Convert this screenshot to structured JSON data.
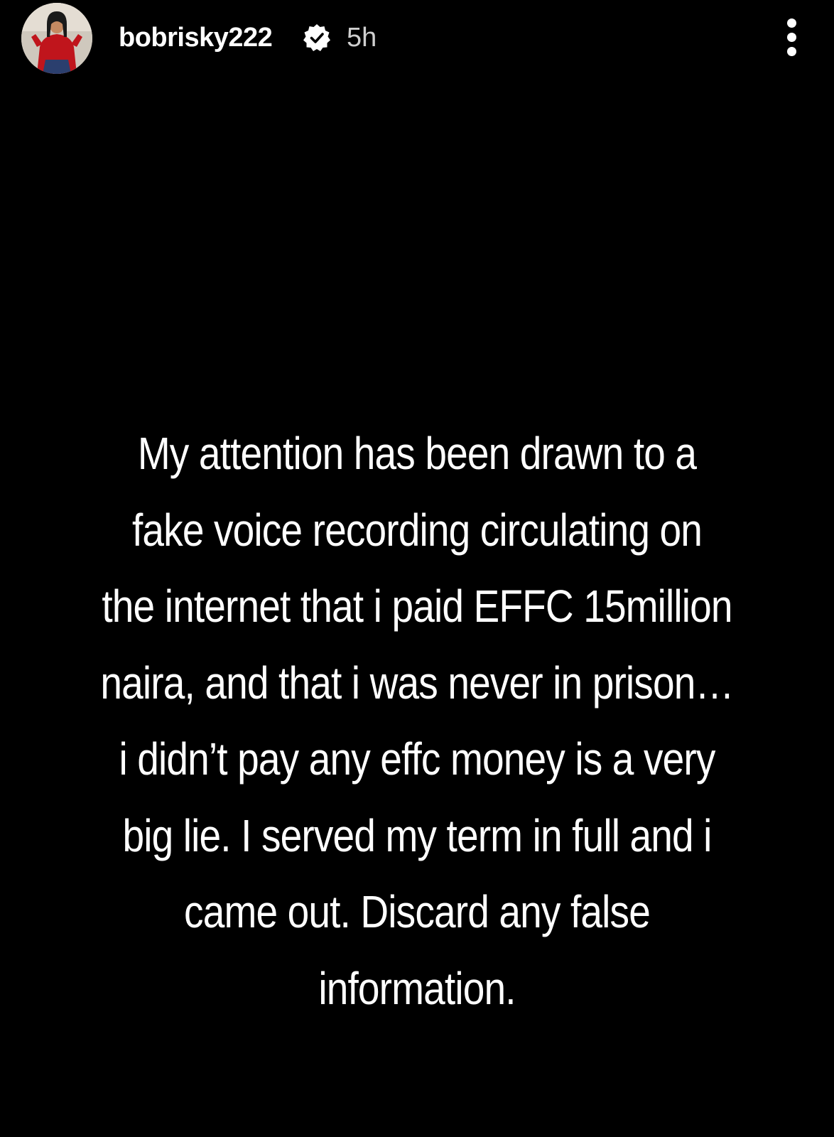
{
  "story": {
    "header": {
      "username": "bobrisky222",
      "time_ago": "5h",
      "verified": true,
      "icons": {
        "avatar": "profile-avatar",
        "verified": "verified-badge-icon",
        "more": "more-options-icon"
      }
    },
    "message": {
      "lines": [
        "My attention has been drawn to a",
        "fake voice recording circulating on",
        "the internet that i paid EFFC 15million",
        "naira, and that i was never in prison…",
        "i didn’t pay any effc money  is a very",
        "big lie. I served my term in full and i",
        "came out. Discard any false",
        "information."
      ]
    },
    "colors": {
      "background": "#000000",
      "text": "#ffffff",
      "time_text": "#cfcfcf"
    }
  }
}
